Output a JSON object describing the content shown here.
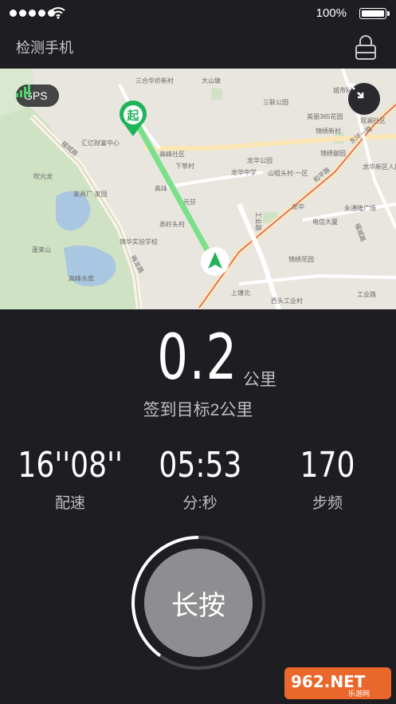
{
  "status_bar": {
    "battery": "100%"
  },
  "nav": {
    "title": "检测手机"
  },
  "map": {
    "gps_label": "GPS",
    "start_marker": "起",
    "labels": [
      "三合华侨新村",
      "大山墩",
      "三联公园",
      "城市明珠",
      "美丽365花园",
      "锦绣新村",
      "汇亿财富中心",
      "高峰社区",
      "下草村",
      "龙华公园",
      "龙华中学",
      "山咀头村·一区",
      "锦绣御园",
      "福城路",
      "龙华",
      "吹元龙",
      "家具厂·家园",
      "元芬",
      "工业路",
      "高峰",
      "电信大厦",
      "赤岭头村",
      "和平路",
      "永通隆广场",
      "蓬莱山",
      "锦华实验学校",
      "高峰水库",
      "梅龙路",
      "锦绣花园",
      "上塘北",
      "西头工业村",
      "工业路",
      "观澜社区",
      "龙华新区人民医院",
      "东环一路",
      "福城路"
    ]
  },
  "run": {
    "distance": "0.2",
    "distance_unit": "公里",
    "goal": "签到目标2公里"
  },
  "stats": [
    {
      "value": "16''08''",
      "label": "配速"
    },
    {
      "value": "05:53",
      "label": "分:秒"
    },
    {
      "value": "170",
      "label": "步频"
    }
  ],
  "hold_button": {
    "label": "长按",
    "progress": 0.4
  },
  "watermark": {
    "text": "962.NET",
    "sub": "乐游网"
  },
  "colors": {
    "background": "#1e1e22",
    "route": "#7be08a",
    "accent": "#1fb35a",
    "button": "#8e8e91"
  }
}
